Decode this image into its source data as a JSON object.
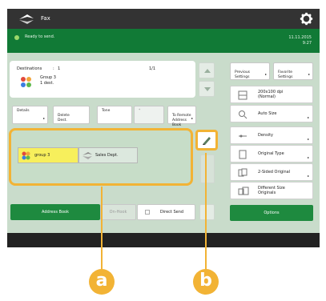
{
  "header": {
    "app_title": "Fax"
  },
  "status": {
    "text": "Ready to send.",
    "date": "11.11.2015",
    "time": "9:27"
  },
  "destinations": {
    "label": "Destinations",
    "separator": ":",
    "count": "1",
    "page": "1/1",
    "name": "Group 3",
    "sub": "1 dest."
  },
  "option_buttons": {
    "details": "Details",
    "delete": "Delete\nDest.",
    "tone": "Tone",
    "star": "*",
    "to_remote": "To Remote\nAddress Book"
  },
  "group_chips": [
    {
      "label": "group 3"
    },
    {
      "label": "Sales Dept."
    }
  ],
  "bottom": {
    "address_book": "Address Book",
    "on_hook": "On-Hook",
    "direct_send": "Direct Send"
  },
  "right_panel": {
    "previous": "Previous\nSettings",
    "favorite": "Favorite\nSettings",
    "resolution": "200x100 dpi\n(Normal)",
    "auto_size": "Auto Size",
    "density": "Density",
    "original_type": "Original Type",
    "two_sided": "2-Sided Original",
    "different_size": "Different Size\nOriginals",
    "options": "Options"
  },
  "callouts": {
    "a": "a",
    "b": "b"
  },
  "colors": {
    "header": "#333333",
    "status_bar": "#117a36",
    "panel": "#c9dccb",
    "accent_green": "#1e8a3f",
    "highlight": "#f2b335",
    "selected_chip": "#f7ef5c"
  }
}
